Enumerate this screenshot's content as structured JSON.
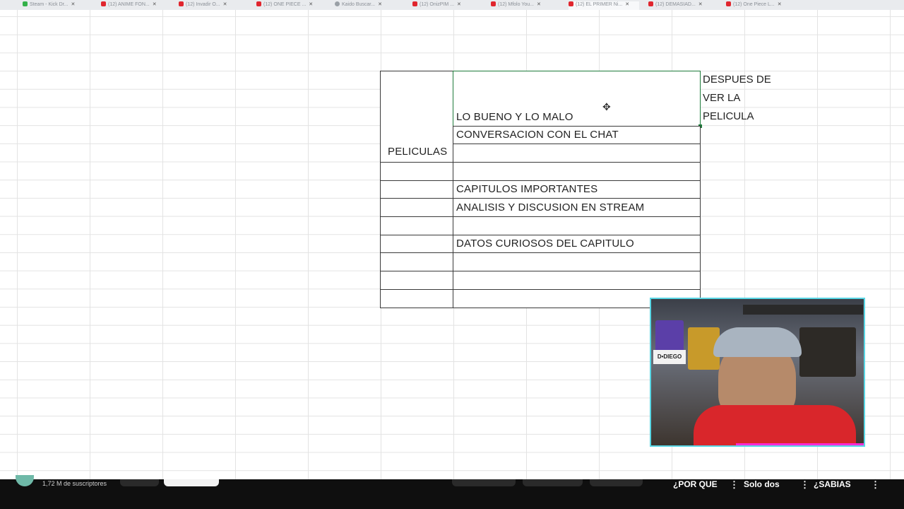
{
  "browser": {
    "tabs": [
      "Steam - Kick Dr...",
      "(12) ANIME FON...",
      "(12) Invadir O...",
      "(12) ONE PIECE ...",
      "Kaido Buscar...",
      "(12) OnizPIM ...",
      "(12) Mfolo You...",
      "(12) EL PRIMER Ni...",
      "(12) DEMASIAD...",
      "(12) One Piece L..."
    ]
  },
  "sheet": {
    "peliculas_label": "PELICULAS",
    "rows": [
      "LO BUENO Y LO MALO",
      "CONVERSACION CON EL CHAT",
      "",
      "",
      "CAPITULOS IMPORTANTES",
      "ANALISIS Y DISCUSION EN STREAM",
      "",
      "DATOS CURIOSOS DEL CAPITULO",
      "",
      "",
      ""
    ],
    "side_note": "DESPUES DE\nVER LA\nPELICULA"
  },
  "webcam": {
    "sign_text": "D•DIEGO"
  },
  "bottom_bar": {
    "subscribers": "1,72 M de suscriptores",
    "shorts": [
      "¿POR QUE",
      "Solo dos",
      "¿SABIAS"
    ]
  },
  "colors": {
    "selection": "#1e7b3b",
    "webcam_border": "#59d6e4",
    "webcam_accent": "#ff2ad4"
  }
}
